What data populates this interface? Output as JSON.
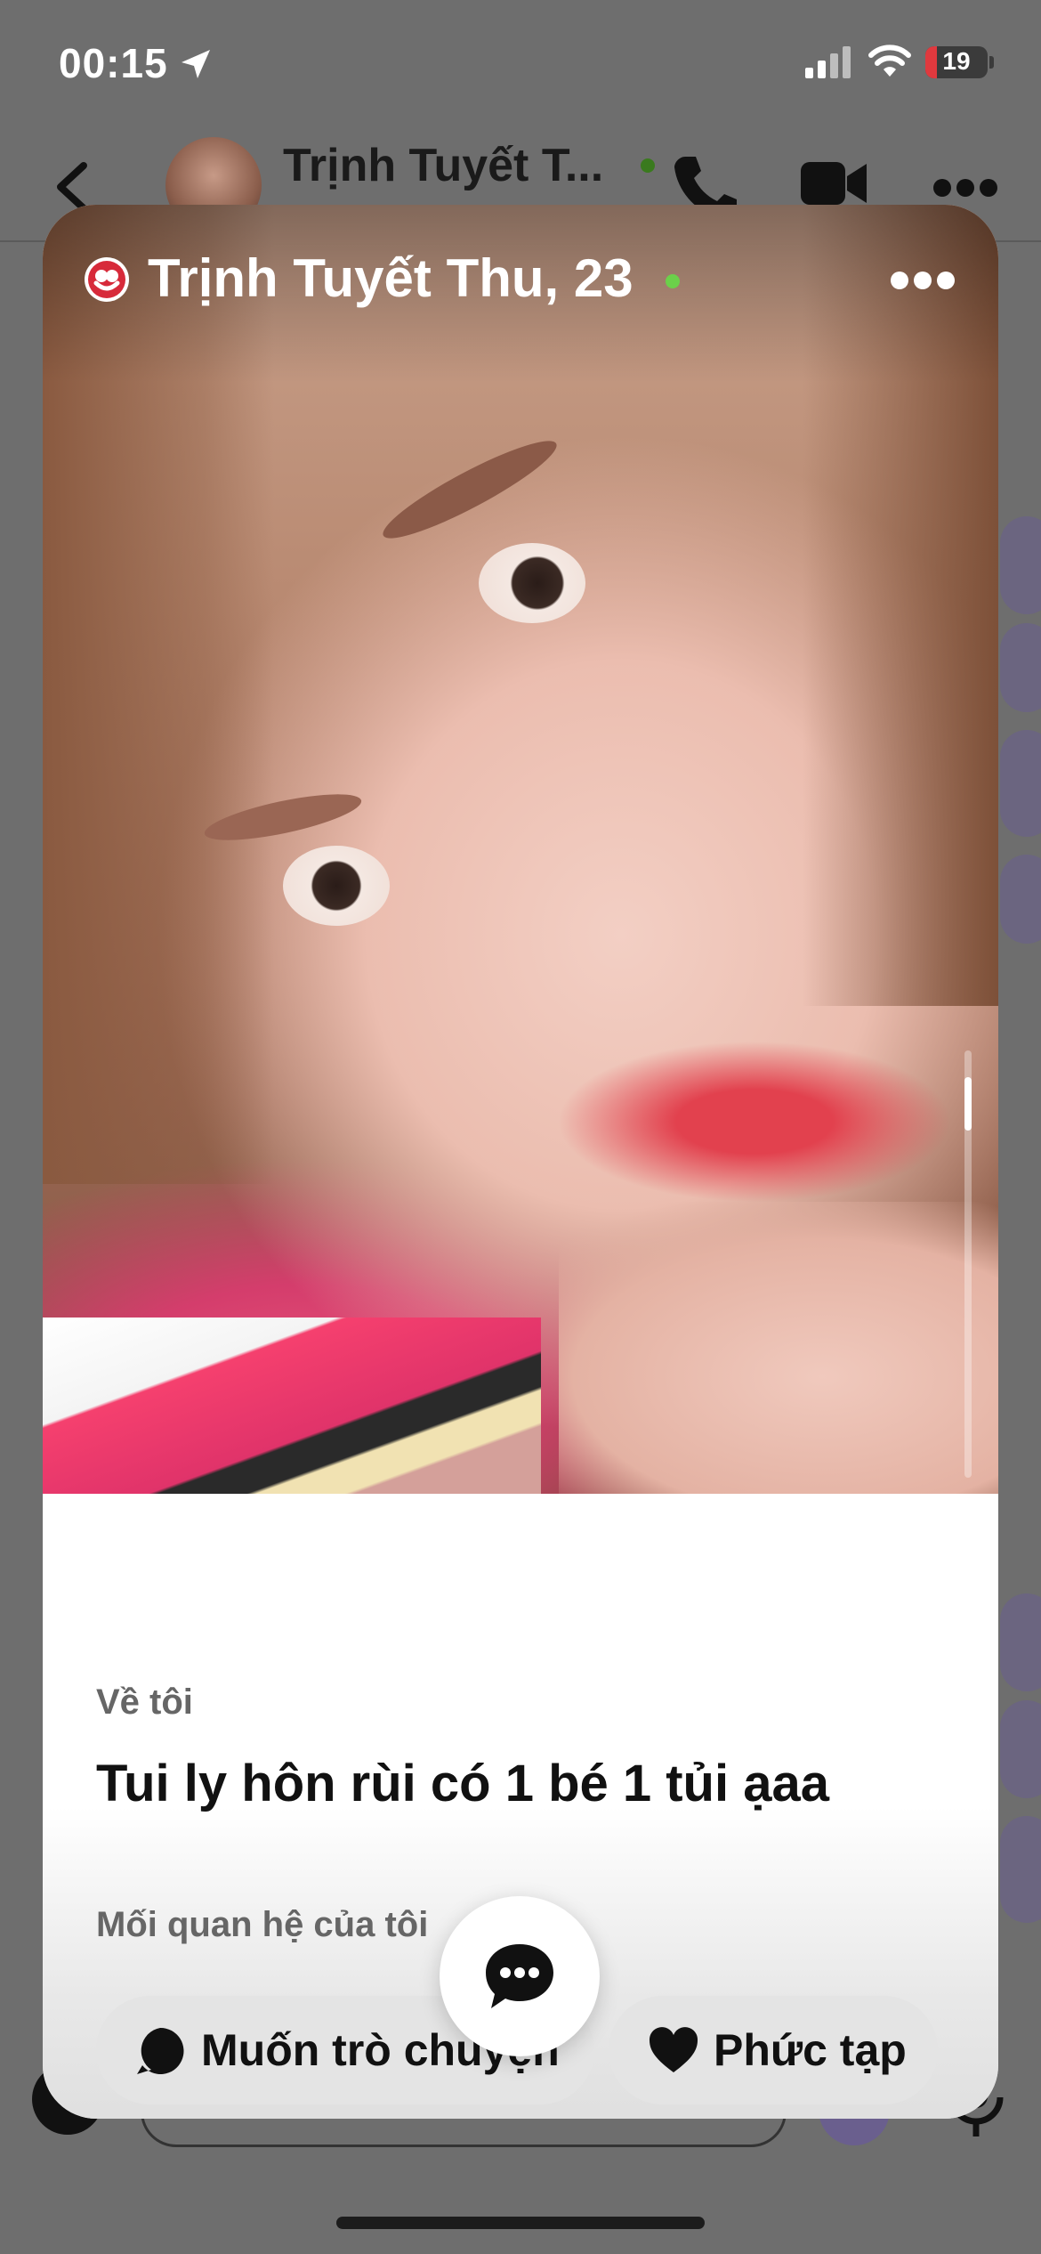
{
  "status_bar": {
    "time": "00:15",
    "battery": "19",
    "battery_level": 0.19,
    "battery_color": "#e0393e"
  },
  "chat_header": {
    "name": "Trịnh Tuyết T...",
    "online_color": "#3a7a1e"
  },
  "card": {
    "name_age": "Trịnh Tuyết Thu, 23",
    "online_color": "#6bd04a",
    "about_label": "Về tôi",
    "about_text": "Tui ly hôn rùi có 1 bé 1 tủi ạaa",
    "relationship_label": "Mối quan hệ của tôi",
    "chips": [
      {
        "label": "Muốn trò chuyện",
        "icon": "chat-bubble-icon"
      },
      {
        "label": "Phức tạp",
        "icon": "heart-icon"
      }
    ]
  },
  "icons": {
    "back": "chevron-left-icon",
    "phone": "phone-icon",
    "video": "video-camera-icon",
    "more": "more-dots-icon",
    "brand": "app-logo-icon",
    "message": "message-bubble-icon"
  }
}
